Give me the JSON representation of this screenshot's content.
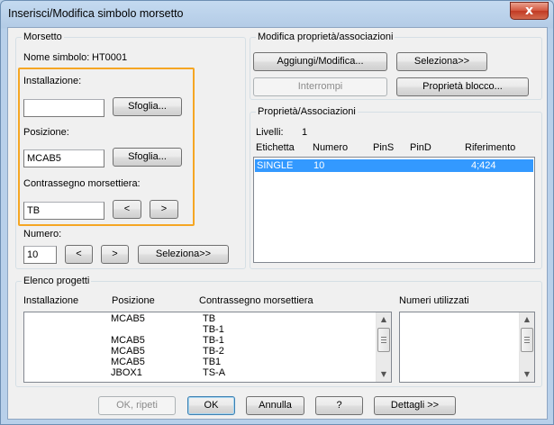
{
  "window": {
    "title": "Inserisci/Modifica simbolo morsetto",
    "close_glyph": "x"
  },
  "morsetto": {
    "group_label": "Morsetto",
    "nome_label": "Nome simbolo:",
    "nome_value": "HT0001",
    "installazione_label": "Installazione:",
    "installazione_value": "",
    "installazione_browse": "Sfoglia...",
    "posizione_label": "Posizione:",
    "posizione_value": "MCAB5",
    "posizione_browse": "Sfoglia...",
    "contrassegno_label": "Contrassegno morsettiera:",
    "contrassegno_value": "TB",
    "prev_label": "<",
    "next_label": ">",
    "numero_label": "Numero:",
    "numero_value": "10",
    "numero_prev": "<",
    "numero_next": ">",
    "seleziona_label": "Seleziona>>"
  },
  "modifica": {
    "group_label": "Modifica proprietà/associazioni",
    "aggiungi_label": "Aggiungi/Modifica...",
    "seleziona_label": "Seleziona>>",
    "interrompi_label": "Interrompi",
    "proprieta_blocco_label": "Proprietà blocco..."
  },
  "proprieta": {
    "group_label": "Proprietà/Associazioni",
    "livelli_label": "Livelli:",
    "livelli_value": "1",
    "columns": [
      "Etichetta",
      "Numero",
      "PinS",
      "PinD",
      "Riferimento"
    ],
    "rows": [
      {
        "etichetta": "SINGLE",
        "numero": "10",
        "pins": "",
        "pind": "",
        "riferimento": "4;424"
      }
    ]
  },
  "elenco": {
    "group_label": "Elenco progetti",
    "columns": [
      "Installazione",
      "Posizione",
      "Contrassegno morsettiera"
    ],
    "numeri_label": "Numeri utilizzati",
    "rows": [
      {
        "installazione": "",
        "posizione": "MCAB5",
        "contrassegno": "TB"
      },
      {
        "installazione": "",
        "posizione": "",
        "contrassegno": "TB-1"
      },
      {
        "installazione": "",
        "posizione": "MCAB5",
        "contrassegno": "TB-1"
      },
      {
        "installazione": "",
        "posizione": "MCAB5",
        "contrassegno": "TB-2"
      },
      {
        "installazione": "",
        "posizione": "MCAB5",
        "contrassegno": "TB1"
      },
      {
        "installazione": "",
        "posizione": "JBOX1",
        "contrassegno": "TS-A"
      }
    ]
  },
  "footer": {
    "ok_ripeti_label": "OK, ripeti",
    "ok_label": "OK",
    "annulla_label": "Annulla",
    "help_label": "?",
    "dettagli_label": "Dettagli >>"
  },
  "colors": {
    "highlight": "#f5a623",
    "selection": "#3399ff"
  }
}
